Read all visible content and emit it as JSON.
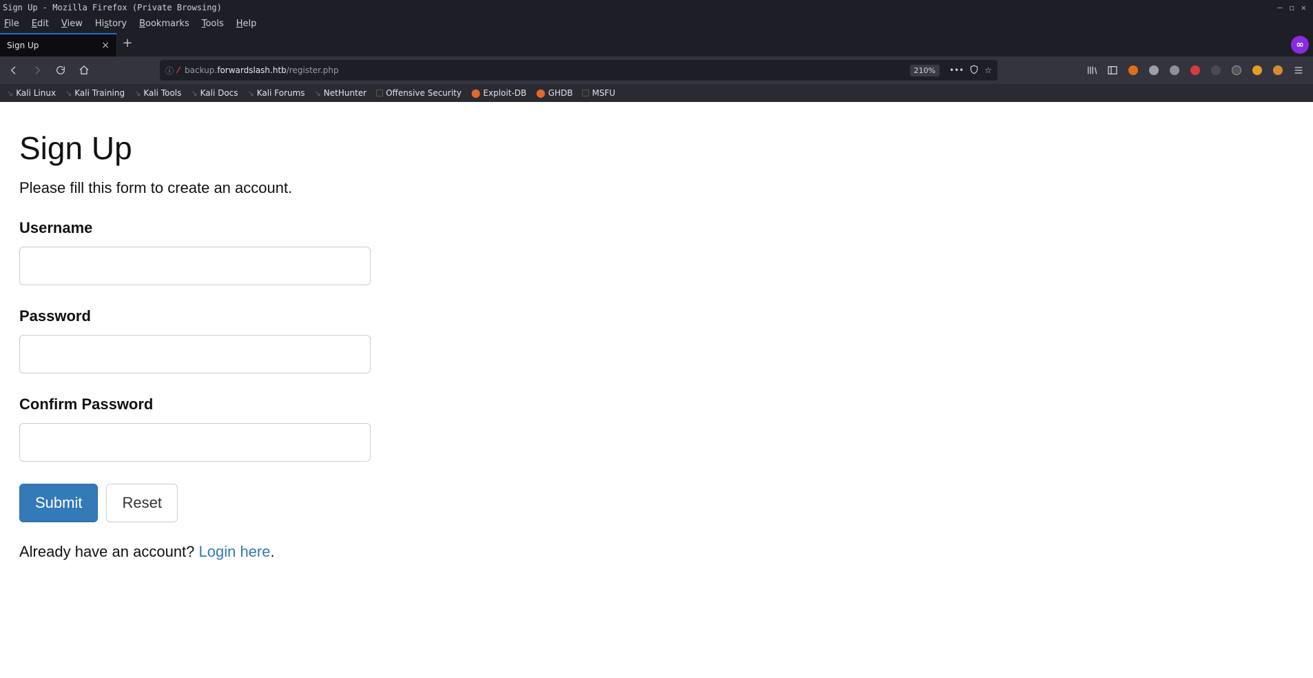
{
  "window": {
    "title": "Sign Up - Mozilla Firefox (Private Browsing)"
  },
  "menu": {
    "file": "File",
    "edit": "Edit",
    "view": "View",
    "history": "History",
    "bookmarks": "Bookmarks",
    "tools": "Tools",
    "help": "Help"
  },
  "tab": {
    "title": "Sign Up"
  },
  "url": {
    "prefix": "backup.",
    "host": "forwardslash.htb",
    "path": "/register.php",
    "zoom": "210%"
  },
  "bookmarks": [
    "Kali Linux",
    "Kali Training",
    "Kali Tools",
    "Kali Docs",
    "Kali Forums",
    "NetHunter",
    "Offensive Security",
    "Exploit-DB",
    "GHDB",
    "MSFU"
  ],
  "form": {
    "heading": "Sign Up",
    "subheading": "Please fill this form to create an account.",
    "username_label": "Username",
    "password_label": "Password",
    "confirm_label": "Confirm Password",
    "submit": "Submit",
    "reset": "Reset",
    "already_text": "Already have an account? ",
    "login_link": "Login here",
    "period": "."
  },
  "privbadge": "∞"
}
